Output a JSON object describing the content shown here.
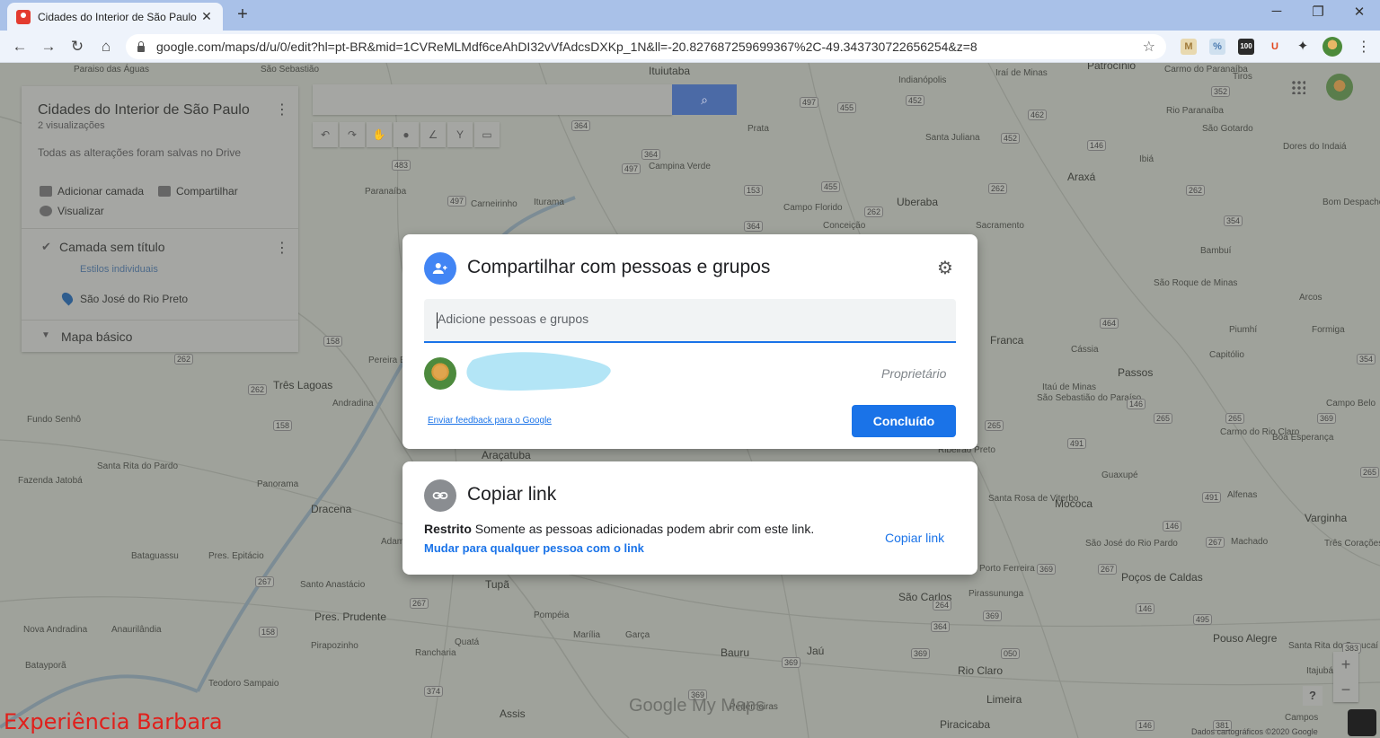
{
  "browser": {
    "tab_title": "Cidades do Interior de São Paulo",
    "url": "google.com/maps/d/u/0/edit?hl=pt-BR&mid=1CVReMLMdf6ceAhDI32vVfAdcsDXKp_1N&ll=-20.827687259699367%2C-49.343730722656254&z=8"
  },
  "panel": {
    "map_title": "Cidades do Interior de São Paulo",
    "views": "2 visualizações",
    "saved_status": "Todas as alterações foram salvas no Drive",
    "add_layer": "Adicionar camada",
    "share": "Compartilhar",
    "preview": "Visualizar",
    "layer_name": "Camada sem título",
    "layer_style": "Estilos individuais",
    "place": "São José do Rio Preto",
    "base_map": "Mapa básico"
  },
  "share_dialog": {
    "title": "Compartilhar com pessoas e grupos",
    "add_placeholder": "Adicione pessoas e grupos",
    "owner_role": "Proprietário",
    "feedback_link": "Enviar feedback para o Google",
    "done_button": "Concluído"
  },
  "copy_dialog": {
    "title": "Copiar link",
    "restricted_label": "Restrito",
    "restricted_desc": "Somente as pessoas adicionadas podem abrir com este link.",
    "change_link": "Mudar para qualquer pessoa com o link",
    "copy_button": "Copiar link"
  },
  "map": {
    "cities": [
      {
        "name": "Paraiso das Águas"
      },
      {
        "name": "São Sebastião"
      },
      {
        "name": "Ituiutaba"
      },
      {
        "name": "Indianópolis"
      },
      {
        "name": "Iraí de Minas"
      },
      {
        "name": "Patrocínio"
      },
      {
        "name": "Carmo do Paranaíba"
      },
      {
        "name": "Tiros"
      },
      {
        "name": "Prata"
      },
      {
        "name": "Santa Juliana"
      },
      {
        "name": "Rio Paranaíba"
      },
      {
        "name": "São Gotardo"
      },
      {
        "name": "Dores do Indaiá"
      },
      {
        "name": "Ibiá"
      },
      {
        "name": "Araxá"
      },
      {
        "name": "Campina Verde"
      },
      {
        "name": "Paranaíba"
      },
      {
        "name": "Carneirinho"
      },
      {
        "name": "Iturama"
      },
      {
        "name": "Campo Florido"
      },
      {
        "name": "Uberaba"
      },
      {
        "name": "Conceição"
      },
      {
        "name": "Sacramento"
      },
      {
        "name": "Bom Despacho"
      },
      {
        "name": "Bambuí"
      },
      {
        "name": "São Roque de Minas"
      },
      {
        "name": "Arcos"
      },
      {
        "name": "Piumhí"
      },
      {
        "name": "Formiga"
      },
      {
        "name": "Franca"
      },
      {
        "name": "Cássia"
      },
      {
        "name": "Capitólio"
      },
      {
        "name": "Passos"
      },
      {
        "name": "Itaú de Minas"
      },
      {
        "name": "São Sebastião do Paraíso"
      },
      {
        "name": "Campo Belo"
      },
      {
        "name": "Três Lagoas"
      },
      {
        "name": "Andradina"
      },
      {
        "name": "Pereira Barreto"
      },
      {
        "name": "Fundo Senhô"
      },
      {
        "name": "Carmo do Rio Claro"
      },
      {
        "name": "Boa Esperança"
      },
      {
        "name": "Ribeirão Preto"
      },
      {
        "name": "Araçatuba"
      },
      {
        "name": "Santa Rita do Pardo"
      },
      {
        "name": "Fazenda Jatobá"
      },
      {
        "name": "Panorama"
      },
      {
        "name": "Guaxupé"
      },
      {
        "name": "Santa Rosa de Viterbo"
      },
      {
        "name": "Mococa"
      },
      {
        "name": "Alfenas"
      },
      {
        "name": "Varginha"
      },
      {
        "name": "Dracena"
      },
      {
        "name": "Adamantina"
      },
      {
        "name": "São José do Rio Pardo"
      },
      {
        "name": "Machado"
      },
      {
        "name": "Três Corações"
      },
      {
        "name": "Bataguassu"
      },
      {
        "name": "Pres. Epitácio"
      },
      {
        "name": "Porto Ferreira"
      },
      {
        "name": "Poços de Caldas"
      },
      {
        "name": "Tupã"
      },
      {
        "name": "Santo Anastácio"
      },
      {
        "name": "São Carlos"
      },
      {
        "name": "Pirassununga"
      },
      {
        "name": "Pres. Prudente"
      },
      {
        "name": "Pompéia"
      },
      {
        "name": "Nova Andradina"
      },
      {
        "name": "Anaurilândia"
      },
      {
        "name": "Marília"
      },
      {
        "name": "Garça"
      },
      {
        "name": "Pouso Alegre"
      },
      {
        "name": "Pirapozinho"
      },
      {
        "name": "Quatá"
      },
      {
        "name": "Bauru"
      },
      {
        "name": "Jaú"
      },
      {
        "name": "Batayporã"
      },
      {
        "name": "Rancharia"
      },
      {
        "name": "Santa Rita do Sapucaí"
      },
      {
        "name": "Rio Claro"
      },
      {
        "name": "Itajubá"
      },
      {
        "name": "Teodoro Sampaio"
      },
      {
        "name": "Limeira"
      },
      {
        "name": "Pederneiras"
      },
      {
        "name": "Assis"
      },
      {
        "name": "Piracicaba"
      },
      {
        "name": "Campos"
      }
    ],
    "logo": "Google My Maps",
    "attribution": "Dados cartográficos ©2020 Google",
    "watermark": "Experiência Barbara"
  }
}
